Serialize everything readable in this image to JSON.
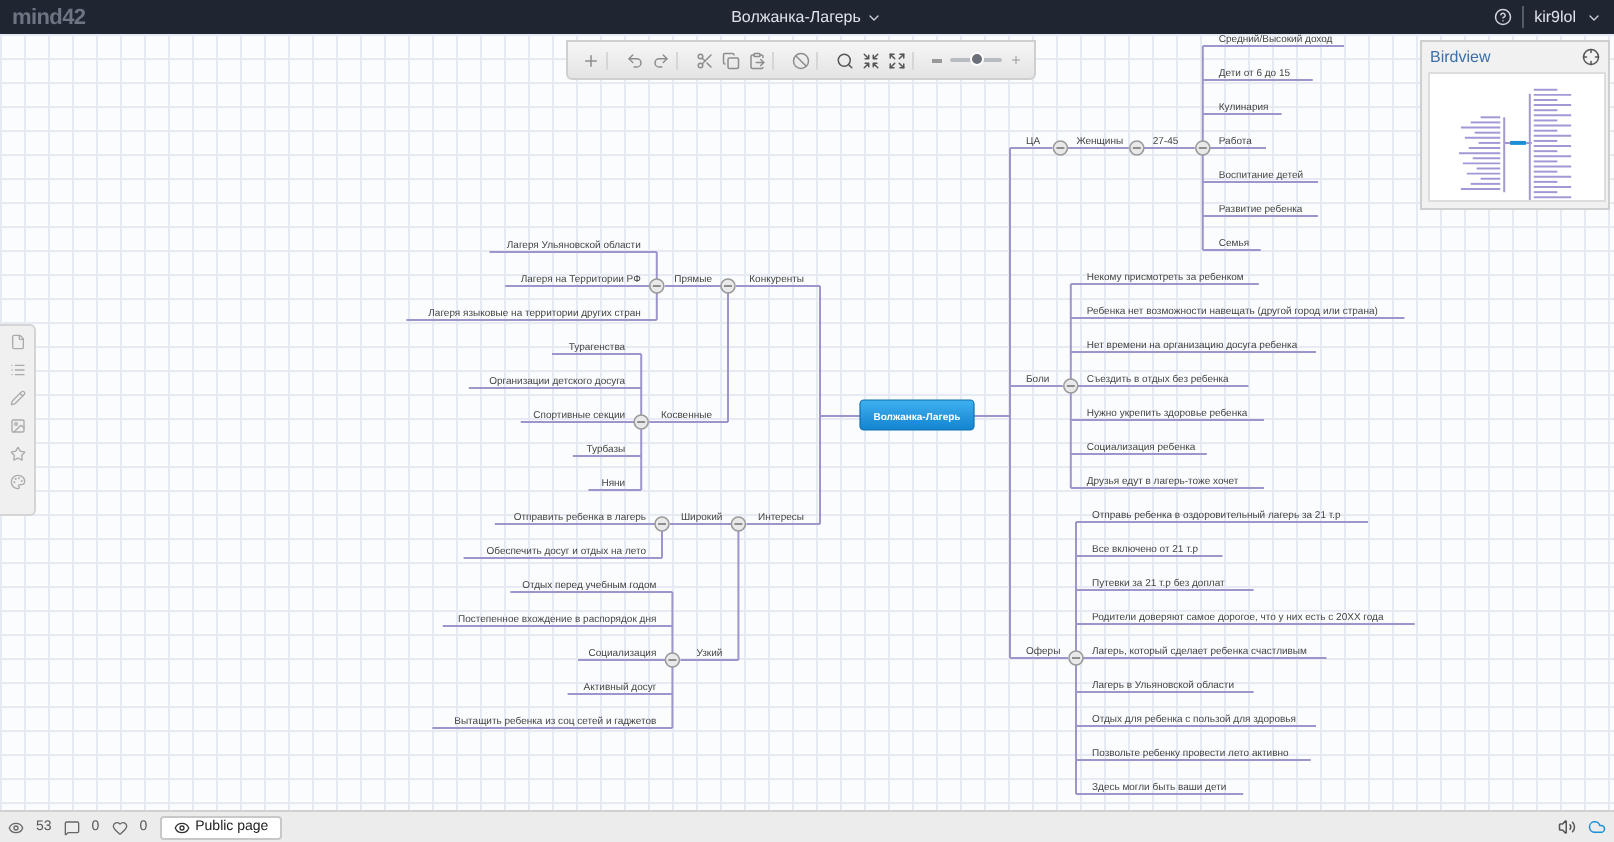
{
  "app": {
    "logo": "mind42"
  },
  "title": "Волжанка-Лагерь",
  "user": {
    "name": "kir9lol"
  },
  "toolbar": {
    "zoom": {
      "level": 0.55
    }
  },
  "birdview": {
    "title": "Birdview"
  },
  "map": {
    "root": "Волжанка-Лагерь",
    "right": [
      {
        "label": "ЦА",
        "expanded": true,
        "children": [
          {
            "label": "Женщины",
            "expanded": true,
            "children": [
              {
                "label": "27-45",
                "expanded": true,
                "children": [
                  {
                    "label": "Средний/Высокий доход"
                  },
                  {
                    "label": "Дети от 6 до 15"
                  },
                  {
                    "label": "Кулинария"
                  },
                  {
                    "label": "Работа"
                  },
                  {
                    "label": "Воспитание детей"
                  },
                  {
                    "label": "Развитие ребенка"
                  },
                  {
                    "label": "Семья"
                  }
                ]
              }
            ]
          }
        ]
      },
      {
        "label": "Боли",
        "expanded": true,
        "children": [
          {
            "label": "Некому присмотреть за ребенком"
          },
          {
            "label": "Ребенка нет возможности навещать (другой город или страна)"
          },
          {
            "label": "Нет времени на организацию досуга ребенка"
          },
          {
            "label": "Съездить в отдых без ребенка"
          },
          {
            "label": "Нужно укрепить здоровье ребенка"
          },
          {
            "label": "Социализация ребенка"
          },
          {
            "label": "Друзья едут в лагерь-тоже хочет"
          }
        ]
      },
      {
        "label": "Оферы",
        "expanded": true,
        "children": [
          {
            "label": "Отправь ребенка в оздоровительный лагерь за 21 т.р"
          },
          {
            "label": "Все включено от 21 т.р"
          },
          {
            "label": "Путевки за 21 т.р без доплат"
          },
          {
            "label": "Родители доверяют самое дорогое, что у них есть с 20ХХ года"
          },
          {
            "label": "Лагерь, который сделает ребенка счастливым"
          },
          {
            "label": "Лагерь в Ульяновской области"
          },
          {
            "label": "Отдых для ребенка с пользой для здоровья"
          },
          {
            "label": "Позвольте ребенку провести лето активно"
          },
          {
            "label": "Здесь могли быть ваши дети"
          }
        ]
      }
    ],
    "left": [
      {
        "label": "Конкуренты",
        "expanded": true,
        "children": [
          {
            "label": "Прямые",
            "expanded": true,
            "children": [
              {
                "label": "Лагеря Ульяновской области"
              },
              {
                "label": "Лагеря на Территории РФ"
              },
              {
                "label": "Лагеря языковые на территории других стран"
              }
            ]
          },
          {
            "label": "Косвенные",
            "expanded": true,
            "children": [
              {
                "label": "Турагенства"
              },
              {
                "label": "Организации детского досуга"
              },
              {
                "label": "Спортивные секции"
              },
              {
                "label": "Турбазы"
              },
              {
                "label": "Няни"
              }
            ]
          }
        ]
      },
      {
        "label": "Интересы",
        "expanded": true,
        "children": [
          {
            "label": "Широкий",
            "expanded": true,
            "children": [
              {
                "label": "Отправить ребенка в лагерь"
              },
              {
                "label": "Обеспечить досуг и отдых на лето"
              }
            ]
          },
          {
            "label": "Узкий",
            "expanded": true,
            "children": [
              {
                "label": "Отдых перед учебным годом"
              },
              {
                "label": "Постепенное вхождение в распорядок дня"
              },
              {
                "label": "Социализация"
              },
              {
                "label": "Активный досуг"
              },
              {
                "label": "Вытащить ребенка из соц сетей и гаджетов"
              }
            ]
          }
        ]
      }
    ]
  },
  "stats": {
    "views": "53",
    "comments": "0",
    "likes": "0"
  },
  "public_button": "Public page"
}
